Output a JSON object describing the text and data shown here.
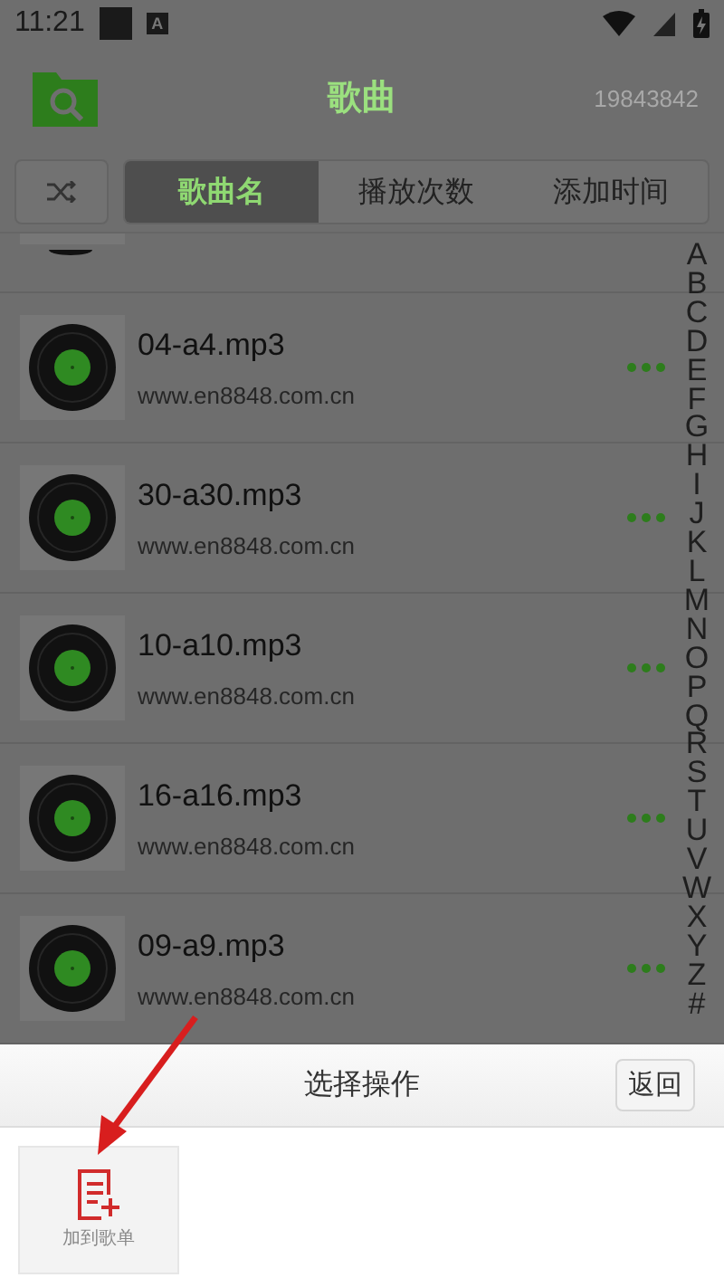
{
  "status_bar": {
    "time": "11:21",
    "notice_letter": "A"
  },
  "header": {
    "title": "歌曲",
    "count": "19843842"
  },
  "tabs": [
    {
      "label": "歌曲名",
      "selected": true
    },
    {
      "label": "播放次数",
      "selected": false
    },
    {
      "label": "添加时间",
      "selected": false
    }
  ],
  "songs": [
    {
      "title": "04-a4.mp3",
      "subtitle": "www.en8848.com.cn"
    },
    {
      "title": "30-a30.mp3",
      "subtitle": "www.en8848.com.cn"
    },
    {
      "title": "10-a10.mp3",
      "subtitle": "www.en8848.com.cn"
    },
    {
      "title": "16-a16.mp3",
      "subtitle": "www.en8848.com.cn"
    },
    {
      "title": "09-a9.mp3",
      "subtitle": "www.en8848.com.cn"
    }
  ],
  "index_letters": [
    "A",
    "B",
    "C",
    "D",
    "E",
    "F",
    "G",
    "H",
    "I",
    "J",
    "K",
    "L",
    "M",
    "N",
    "O",
    "P",
    "Q",
    "R",
    "S",
    "T",
    "U",
    "V",
    "W",
    "X",
    "Y",
    "Z",
    "#"
  ],
  "sheet": {
    "title": "选择操作",
    "back_button": "返回",
    "actions": [
      {
        "label": "加到歌单"
      }
    ]
  }
}
